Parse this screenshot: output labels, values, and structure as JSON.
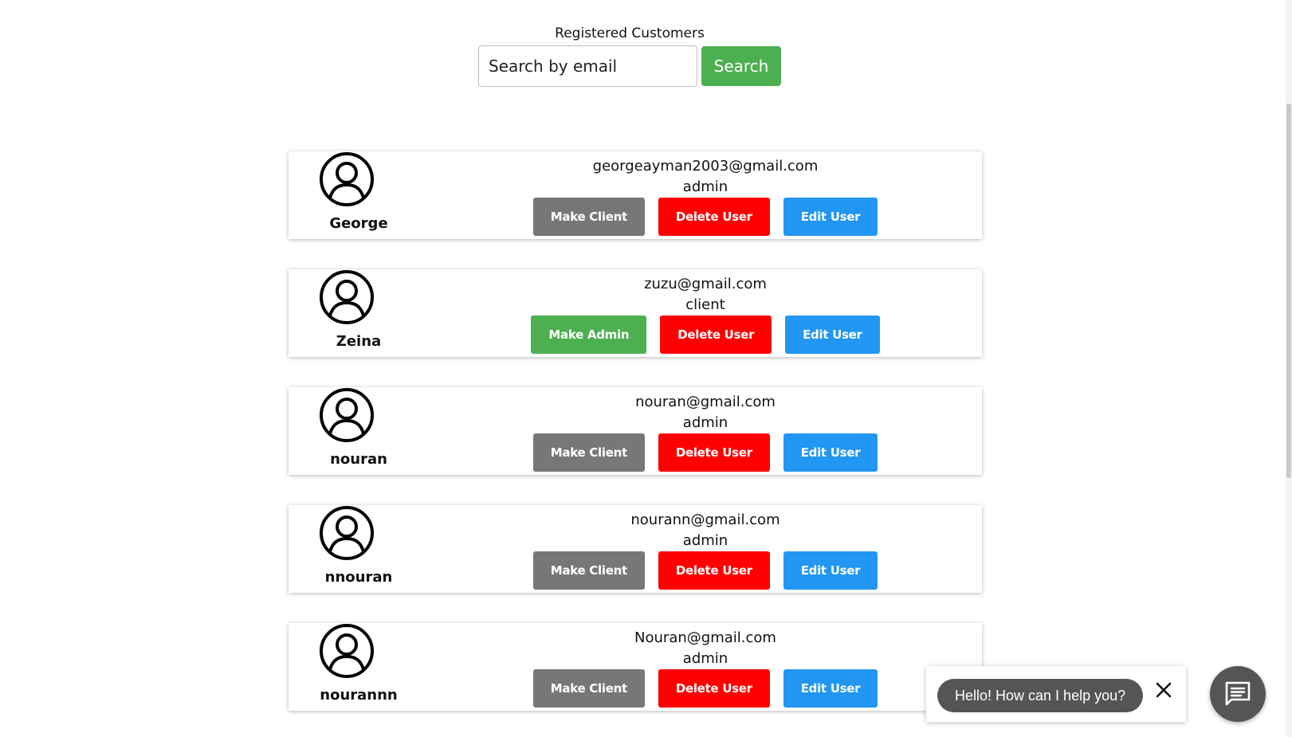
{
  "header": {
    "title": "Registered Customers"
  },
  "search": {
    "placeholder": "Search by email",
    "button_label": "Search"
  },
  "customers": [
    {
      "name": "George",
      "email": "georgeayman2003@gmail.com",
      "role": "admin",
      "role_button": "Make Client",
      "delete_button": "Delete User",
      "edit_button": "Edit User"
    },
    {
      "name": "Zeina",
      "email": "zuzu@gmail.com",
      "role": "client",
      "role_button": "Make Admin",
      "delete_button": "Delete User",
      "edit_button": "Edit User"
    },
    {
      "name": "nouran",
      "email": "nouran@gmail.com",
      "role": "admin",
      "role_button": "Make Client",
      "delete_button": "Delete User",
      "edit_button": "Edit User"
    },
    {
      "name": "nnouran",
      "email": "nourann@gmail.com",
      "role": "admin",
      "role_button": "Make Client",
      "delete_button": "Delete User",
      "edit_button": "Edit User"
    },
    {
      "name": "nourannn",
      "email": "Nouran@gmail.com",
      "role": "admin",
      "role_button": "Make Client",
      "delete_button": "Delete User",
      "edit_button": "Edit User"
    }
  ],
  "chat": {
    "greeting": "Hello! How can I help you?",
    "close_icon": "close-icon",
    "launcher_icon": "chat-icon"
  },
  "colors": {
    "search_button": "#4caf50",
    "make_client": "#777777",
    "make_admin": "#4caf50",
    "delete": "#ff0000",
    "edit": "#2196f3",
    "chat_bubble": "#555555"
  }
}
